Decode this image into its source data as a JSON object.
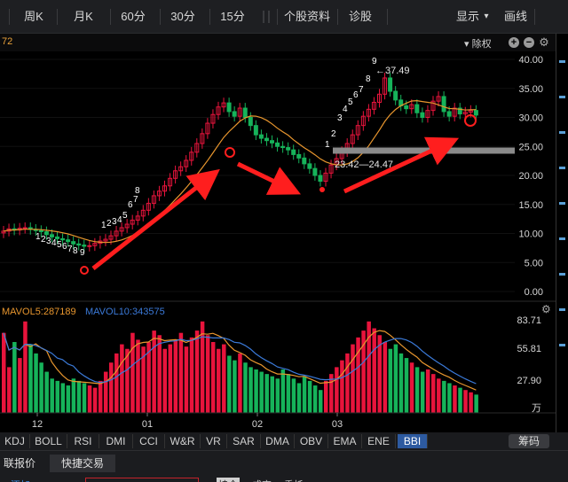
{
  "toolbar": {
    "buttons": [
      "周K",
      "月K",
      "60分",
      "30分",
      "15分",
      "个股资料",
      "诊股",
      "显示",
      "画线"
    ],
    "display_dropdown": "▾"
  },
  "subbar": {
    "ma_label": "72",
    "fq_label": "除权",
    "fq_arrow": "▾",
    "zoom_in": "+",
    "zoom_out": "−",
    "settings": "⚙"
  },
  "price_axis": [
    "40.00",
    "35.00",
    "30.00",
    "25.00",
    "20.00",
    "15.00",
    "10.00",
    "5.00",
    "0.00"
  ],
  "volume_panel": {
    "legend_ma5": "MAVOL5:287189",
    "legend_ma10": "MAVOL10:343575",
    "axis": [
      "83.71",
      "55.81",
      "27.90",
      "万"
    ]
  },
  "time_axis": [
    "12",
    "01",
    "02",
    "03"
  ],
  "annotations": {
    "high_price": "←37.49",
    "range": "23.42—24.47"
  },
  "indicator_tabs": [
    "KDJ",
    "BOLL",
    "RSI",
    "DMI",
    "CCI",
    "W&R",
    "VR",
    "SAR",
    "DMA",
    "OBV",
    "EMA",
    "ENE",
    "BBI"
  ],
  "indicator_active": "BBI",
  "chip_button": "筹码",
  "bottom_tabs": [
    "联报价",
    "快捷交易"
  ],
  "bottom_row": [
    "添加",
    "持仓",
    "成交",
    "委托"
  ],
  "colors": {
    "up": "#e8143c",
    "down": "#16b35a",
    "ma_orange": "#e8962e",
    "ma_blue": "#3b7ad9",
    "arrow": "#ff1e1e",
    "axis_text": "#d6d6d6"
  },
  "chart_data": {
    "type": "candlestick",
    "y_axis_range": [
      0,
      40
    ],
    "y_ticks": [
      40,
      35,
      30,
      25,
      20,
      15,
      10,
      5,
      0
    ],
    "x_ticks": [
      "12",
      "01",
      "02",
      "03"
    ],
    "nine_counts": [
      "1",
      "2",
      "3",
      "4",
      "5",
      "6",
      "7",
      "8",
      "9"
    ],
    "annotations": [
      "←37.49",
      "23.42—24.47"
    ]
  }
}
